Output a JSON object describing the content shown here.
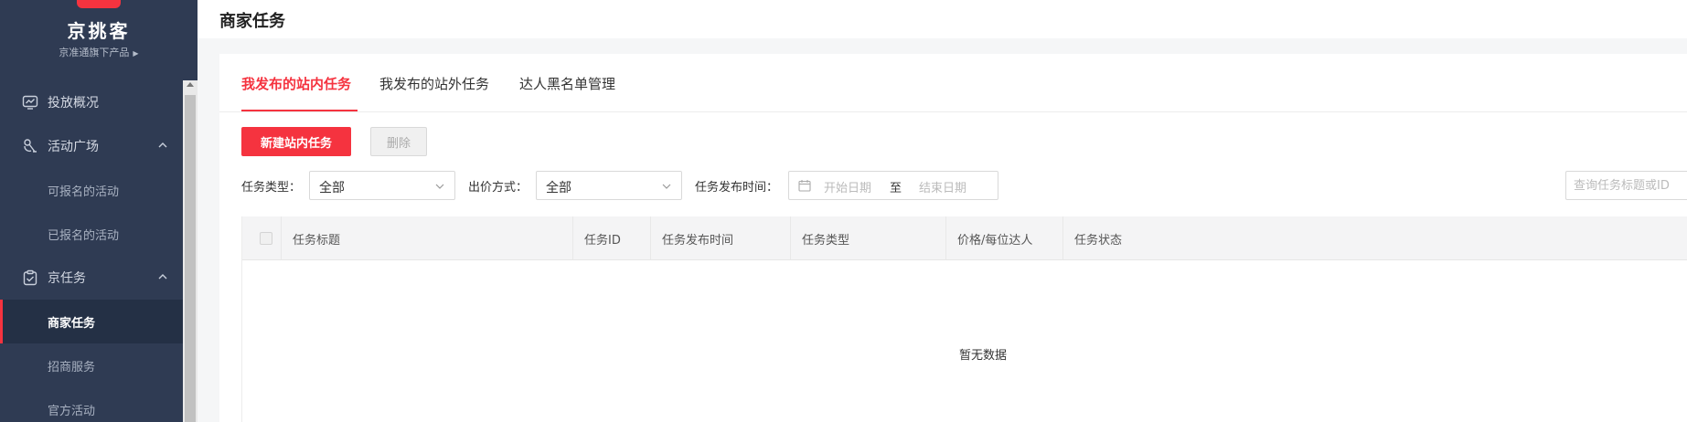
{
  "sidebar": {
    "brand": "京挑客",
    "brand_sub": "京准通旗下产品",
    "menu": [
      {
        "label": "投放概况",
        "icon": "monitor-chart-icon"
      },
      {
        "label": "活动广场",
        "icon": "activity-icon",
        "children": [
          "可报名的活动",
          "已报名的活动"
        ]
      },
      {
        "label": "京任务",
        "icon": "clipboard-icon",
        "children": [
          "商家任务",
          "招商服务",
          "官方活动"
        ]
      }
    ],
    "active_item": "商家任务"
  },
  "header": {
    "title": "商家任务"
  },
  "tabs": [
    {
      "label": "我发布的站内任务",
      "active": true
    },
    {
      "label": "我发布的站外任务",
      "active": false
    },
    {
      "label": "达人黑名单管理",
      "active": false
    }
  ],
  "toolbar": {
    "new_button": "新建站内任务",
    "delete_button": "删除"
  },
  "filters": {
    "task_type_label": "任务类型：",
    "task_type_value": "全部",
    "bid_method_label": "出价方式：",
    "bid_method_value": "全部",
    "publish_time_label": "任务发布时间：",
    "start_placeholder": "开始日期",
    "range_separator": "至",
    "end_placeholder": "结束日期",
    "search_placeholder": "查询任务标题或ID"
  },
  "table": {
    "columns": [
      "任务标题",
      "任务ID",
      "任务发布时间",
      "任务类型",
      "价格/每位达人",
      "任务状态"
    ],
    "empty_text": "暂无数据"
  },
  "colors": {
    "accent": "#f5333f",
    "sidebar_bg": "#2f3b53"
  }
}
